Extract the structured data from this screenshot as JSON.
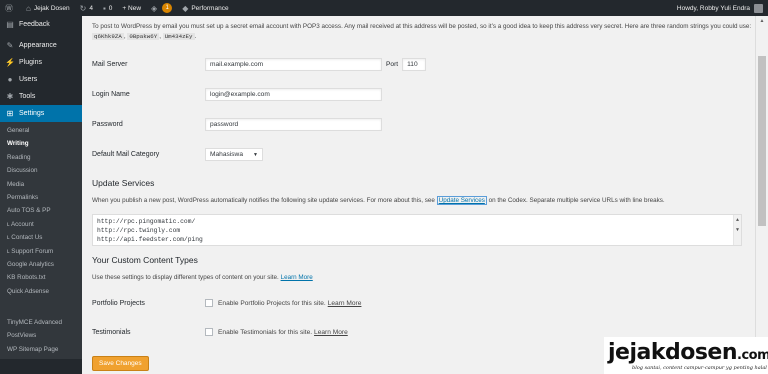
{
  "adminbar": {
    "wp_logo": "wordpress-icon",
    "site_name": "Jejak Dosen",
    "updates_count": "4",
    "comments_count": "0",
    "new_label": "+ New",
    "notification_badge": "1",
    "performance_label": "Performance",
    "howdy": "Howdy, Robby Yuli Endra"
  },
  "sidebar": {
    "top_items": [
      {
        "label": "Feedback",
        "icon": "feedback-icon"
      },
      {
        "label": "Appearance",
        "icon": "paintbrush-icon"
      },
      {
        "label": "Plugins",
        "icon": "plugin-icon"
      },
      {
        "label": "Users",
        "icon": "users-icon"
      },
      {
        "label": "Tools",
        "icon": "wrench-icon"
      },
      {
        "label": "Settings",
        "icon": "settings-icon"
      }
    ],
    "submenu": [
      {
        "label": "General"
      },
      {
        "label": "Writing"
      },
      {
        "label": "Reading"
      },
      {
        "label": "Discussion"
      },
      {
        "label": "Media"
      },
      {
        "label": "Permalinks"
      },
      {
        "label": "Auto TOS & PP"
      },
      {
        "label": "ʟ Account"
      },
      {
        "label": "ʟ Contact Us"
      },
      {
        "label": "ʟ Support Forum"
      },
      {
        "label": "Google Analytics"
      },
      {
        "label": "KB Robots.txt"
      },
      {
        "label": "Quick Adsense"
      },
      {
        "label": "TinyMCE Advanced"
      },
      {
        "label": "PostViews"
      },
      {
        "label": "WP Sitemap Page"
      }
    ],
    "active_item": "Settings",
    "current_sub": "Writing",
    "colors": {
      "background": "#23282d",
      "active": "#0073aa",
      "submenu": "#32373c"
    }
  },
  "intro": {
    "text": "To post to WordPress by email you must set up a secret email account with POP3 access. Any mail received at this address will be posted, so it’s a good idea to keep this address very secret. Here are three random strings you could use:",
    "codes": [
      "q6Khk9ZA",
      "0Bpakw6Y",
      "Um434zEy"
    ]
  },
  "form": {
    "mail_server": {
      "label": "Mail Server",
      "value": "mail.example.com",
      "port_label": "Port",
      "port_value": "110"
    },
    "login_name": {
      "label": "Login Name",
      "value": "login@example.com"
    },
    "password": {
      "label": "Password",
      "value": "password"
    },
    "default_mail_category": {
      "label": "Default Mail Category",
      "value": "Mahasiswa"
    }
  },
  "update_services": {
    "title": "Update Services",
    "desc_before": "When you publish a new post, WordPress automatically notifies the following site update services. For more about this, see",
    "link": "Update Services",
    "desc_after": "on the Codex. Separate multiple service URLs with line breaks.",
    "urls": [
      "http://rpc.pingomatic.com/",
      "http://rpc.twingly.com",
      "http://api.feedster.com/ping"
    ]
  },
  "custom_content": {
    "title": "Your Custom Content Types",
    "desc": "Use these settings to display different types of content on your site.",
    "learn_more": "Learn More",
    "portfolio": {
      "label": "Portfolio Projects",
      "text": "Enable Portfolio Projects for this site.",
      "link": "Learn More"
    },
    "testimonials": {
      "label": "Testimonials",
      "text": "Enable Testimonials for this site.",
      "link": "Learn More"
    }
  },
  "save_button": "Save Changes",
  "watermark": {
    "main": "jejakdosen",
    "suffix": ".com",
    "tagline": "blog santai, content campur-campur yg penting halal"
  }
}
